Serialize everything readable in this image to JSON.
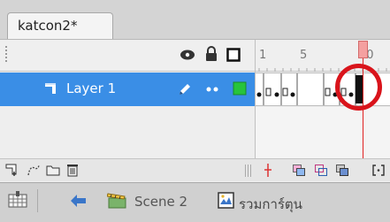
{
  "document_tab": {
    "label": "katcon2*"
  },
  "timeline": {
    "frame_numbers": [
      "1",
      "5",
      "10"
    ],
    "layers": [
      {
        "name": "Layer 1"
      }
    ]
  },
  "status_bar": {
    "scene": "Scene 2",
    "symbol": "รวมการ์ตุน"
  },
  "colors": {
    "selected_layer": "#3a8ee6",
    "playhead": "#e02020",
    "highlight_circle": "#d9141b",
    "outline_square": "#27c43c"
  }
}
